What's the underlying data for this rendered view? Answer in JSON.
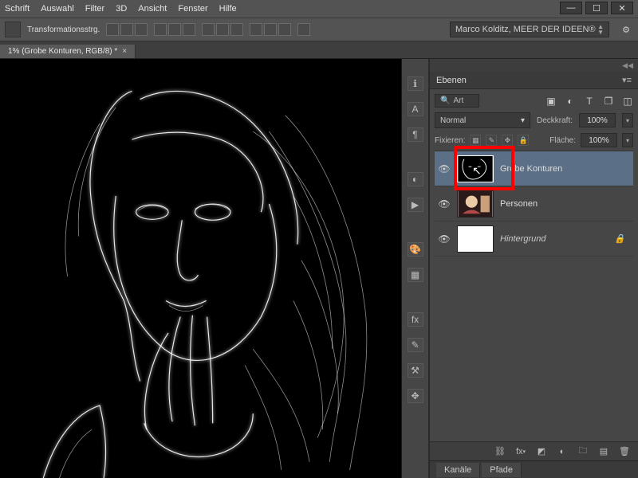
{
  "menu": {
    "items": [
      "Schrift",
      "Auswahl",
      "Filter",
      "3D",
      "Ansicht",
      "Fenster",
      "Hilfe"
    ]
  },
  "winctrl": {
    "min": "—",
    "max": "☐",
    "close": "✕"
  },
  "optionsbar": {
    "label": "Transformationsstrg.",
    "workspace": "Marco Kolditz, MEER DER IDEEN®"
  },
  "tab": {
    "title": "1% (Grobe Konturen, RGB/8) *"
  },
  "layerspanel": {
    "title": "Ebenen",
    "search_label": "Art",
    "blendmode": "Normal",
    "opacity_label": "Deckkraft:",
    "opacity_value": "100%",
    "fill_label": "Fläche:",
    "fill_value": "100%",
    "lock_label": "Fixieren:",
    "layers": [
      {
        "name": "Grobe Konturen",
        "selected": true,
        "locked": false,
        "italic": false
      },
      {
        "name": "Personen",
        "selected": false,
        "locked": false,
        "italic": false
      },
      {
        "name": "Hintergrund",
        "selected": false,
        "locked": true,
        "italic": true
      }
    ],
    "bottom_tabs": [
      "Kanäle",
      "Pfade"
    ]
  }
}
